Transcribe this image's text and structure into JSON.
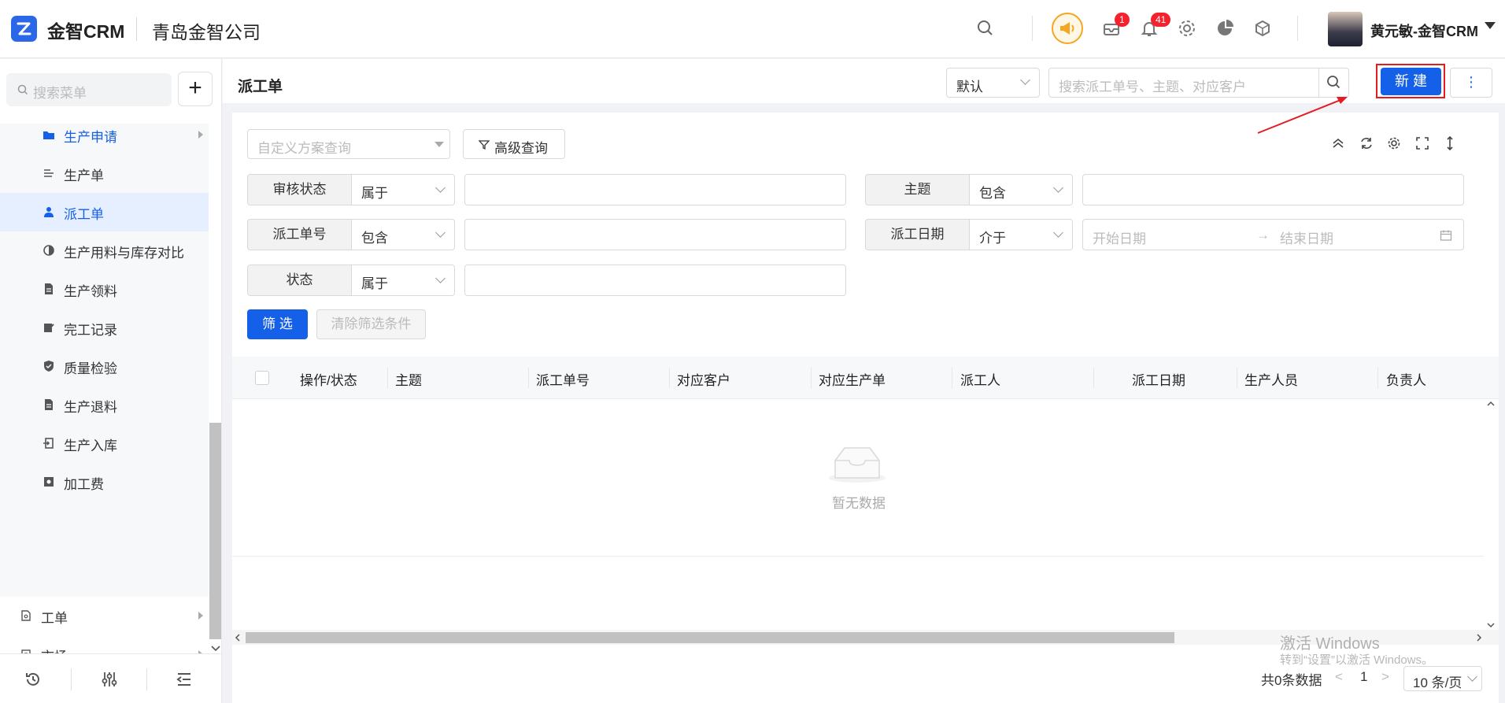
{
  "header": {
    "brand": "金智CRM",
    "company": "青岛金智公司",
    "message_badge": "1",
    "notice_badge": "41",
    "user_name": "黄元敏-金智CRM"
  },
  "sidebar": {
    "search_placeholder": "搜索菜单",
    "add_label": "+",
    "items": [
      {
        "label": "生产申请"
      },
      {
        "label": "生产单"
      },
      {
        "label": "派工单"
      },
      {
        "label": "生产用料与库存对比"
      },
      {
        "label": "生产领料"
      },
      {
        "label": "完工记录"
      },
      {
        "label": "质量检验"
      },
      {
        "label": "生产退料"
      },
      {
        "label": "生产入库"
      },
      {
        "label": "加工费"
      }
    ],
    "top_items": [
      {
        "label": "工单"
      },
      {
        "label": "市场"
      }
    ]
  },
  "page": {
    "title": "派工单",
    "view_select": "默认",
    "search_placeholder": "搜索派工单号、主题、对应客户",
    "new_button": "新 建",
    "more_button": "⋮"
  },
  "filter": {
    "scheme_placeholder": "自定义方案查询",
    "advanced_button": "高级查询",
    "rows": [
      {
        "label": "审核状态",
        "op": "属于"
      },
      {
        "label": "主题",
        "op": "包含"
      },
      {
        "label": "派工单号",
        "op": "包含"
      },
      {
        "label": "派工日期",
        "op": "介于"
      },
      {
        "label": "状态",
        "op": "属于"
      }
    ],
    "start_placeholder": "开始日期",
    "end_placeholder": "结束日期",
    "date_arrow": "→",
    "filter_button": "筛 选",
    "clear_button": "清除筛选条件"
  },
  "table": {
    "columns": [
      "操作/状态",
      "主题",
      "派工单号",
      "对应客户",
      "对应生产单",
      "派工人",
      "派工日期",
      "生产人员",
      "负责人"
    ],
    "empty_text": "暂无数据"
  },
  "pagination": {
    "total": "共0条数据",
    "prev": "<",
    "page": "1",
    "next": ">",
    "page_size": "10 条/页"
  },
  "watermark": {
    "line1": "激活 Windows",
    "line2": "转到“设置”以激活 Windows。"
  },
  "colors": {
    "primary": "#1560e8",
    "highlight_frame": "#e31c23",
    "badge": "#f5222d",
    "horn": "#f5a623"
  }
}
